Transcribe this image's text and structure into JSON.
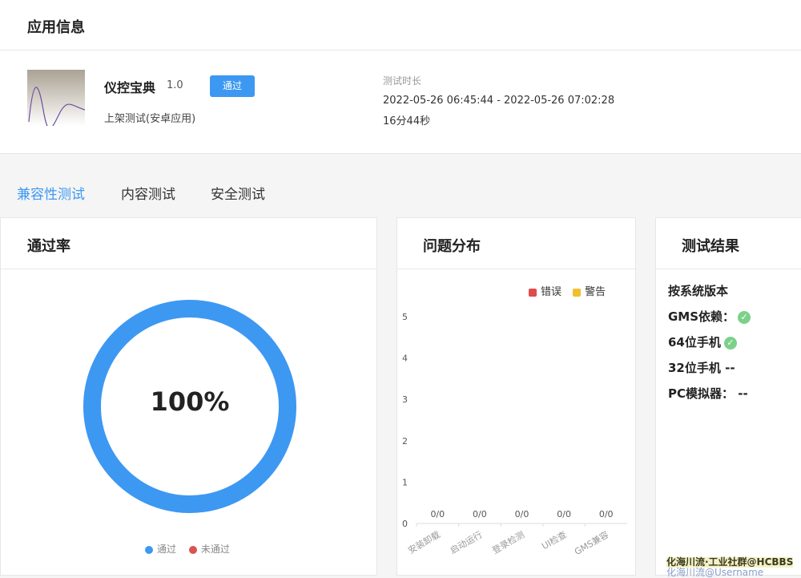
{
  "app_info": {
    "section_title": "应用信息",
    "app_name": "仪控宝典",
    "version": "1.0",
    "status_button": "通过",
    "test_type": "上架测试(安卓应用)",
    "duration_label": "测试时长",
    "time_range": "2022-05-26 06:45:44 - 2022-05-26 07:02:28",
    "duration": "16分44秒"
  },
  "tabs": [
    {
      "label": "兼容性测试",
      "active": true
    },
    {
      "label": "内容测试",
      "active": false
    },
    {
      "label": "安全测试",
      "active": false
    }
  ],
  "pass_rate": {
    "title": "通过率",
    "value_text": "100%",
    "legend_pass": "通过",
    "legend_fail": "未通过",
    "pass_color": "#3d98f2",
    "fail_color": "#d9534f"
  },
  "issues": {
    "title": "问题分布",
    "legend_error": "错误",
    "legend_warning": "警告",
    "error_color": "#e04b4b",
    "warning_color": "#f0c02d"
  },
  "chart_data": {
    "type": "bar",
    "categories": [
      "安装卸载",
      "启动运行",
      "登录检测",
      "UI检查",
      "GMS兼容"
    ],
    "series": [
      {
        "name": "错误",
        "values": [
          0,
          0,
          0,
          0,
          0
        ]
      },
      {
        "name": "警告",
        "values": [
          0,
          0,
          0,
          0,
          0
        ]
      }
    ],
    "data_labels": [
      "0/0",
      "0/0",
      "0/0",
      "0/0",
      "0/0"
    ],
    "yticks": [
      0,
      1,
      2,
      3,
      4,
      5
    ],
    "ylim": [
      0,
      5
    ],
    "legend_position": "top-right",
    "grid": false
  },
  "results": {
    "title": "测试结果",
    "by_version": "按系统版本",
    "gms_label": "GMS依赖：",
    "x64_label": "64位手机",
    "x32_label": "32位手机",
    "x32_value": "--",
    "pc_label": "PC模拟器：",
    "pc_value": "--"
  },
  "watermark": {
    "line1": "化海川流·工业社群@HCBBS",
    "line2": "化海川流@Username"
  }
}
